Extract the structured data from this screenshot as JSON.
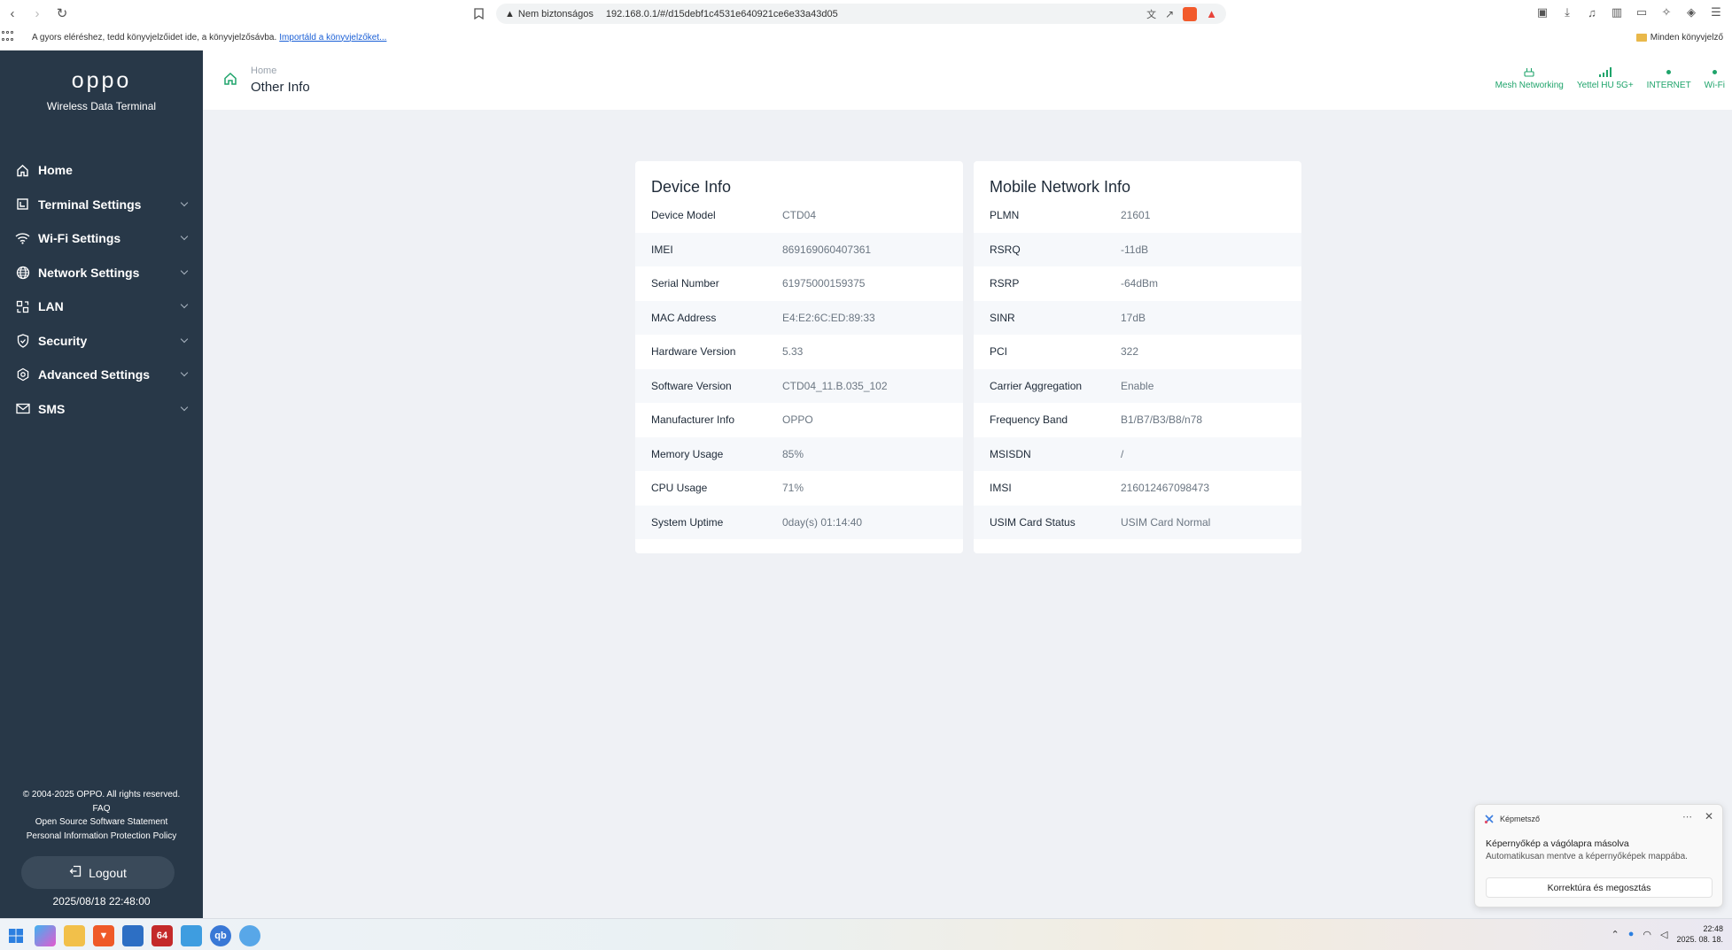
{
  "browser": {
    "security_label": "Nem biztonságos",
    "url": "192.168.0.1/#/d15debf1c4531e640921ce6e33a43d05",
    "bookmarks_hint": "A gyors eléréshez, tedd könyvjelzőidet ide, a könyvjelzősávba.",
    "bookmarks_import": "Importáld a könyvjelzőket...",
    "all_bookmarks": "Minden könyvjelző"
  },
  "sidebar": {
    "logo": "oppo",
    "subtitle": "Wireless Data Terminal",
    "items": [
      {
        "label": "Home",
        "icon": "home-icon",
        "expandable": false
      },
      {
        "label": "Terminal Settings",
        "icon": "terminal-icon",
        "expandable": true
      },
      {
        "label": "Wi-Fi Settings",
        "icon": "wifi-icon",
        "expandable": true
      },
      {
        "label": "Network Settings",
        "icon": "globe-icon",
        "expandable": true
      },
      {
        "label": "LAN",
        "icon": "lan-icon",
        "expandable": true
      },
      {
        "label": "Security",
        "icon": "shield-icon",
        "expandable": true
      },
      {
        "label": "Advanced Settings",
        "icon": "gear-icon",
        "expandable": true
      },
      {
        "label": "SMS",
        "icon": "mail-icon",
        "expandable": true
      }
    ],
    "copyright": "© 2004-2025 OPPO. All rights reserved.",
    "faq": "FAQ",
    "oss": "Open Source Software Statement",
    "privacy": "Personal Information Protection Policy",
    "logout": "Logout",
    "datetime": "2025/08/18 22:48:00"
  },
  "header": {
    "breadcrumb": "Home",
    "title": "Other Info",
    "statuses": [
      {
        "label": "Mesh Networking",
        "icon": "mesh-icon"
      },
      {
        "label": "Yettel HU 5G+",
        "icon": "signal-icon"
      },
      {
        "label": "INTERNET",
        "icon": "dot-icon"
      },
      {
        "label": "Wi-Fi",
        "icon": "dot-icon"
      }
    ],
    "accent": "#1fa46b"
  },
  "device_info": {
    "title": "Device Info",
    "rows": [
      {
        "key": "Device Model",
        "value": "CTD04"
      },
      {
        "key": "IMEI",
        "value": "869169060407361"
      },
      {
        "key": "Serial Number",
        "value": "61975000159375"
      },
      {
        "key": "MAC Address",
        "value": "E4:E2:6C:ED:89:33"
      },
      {
        "key": "Hardware Version",
        "value": "5.33"
      },
      {
        "key": "Software Version",
        "value": "CTD04_11.B.035_102"
      },
      {
        "key": "Manufacturer Info",
        "value": "OPPO"
      },
      {
        "key": "Memory Usage",
        "value": "85%"
      },
      {
        "key": "CPU Usage",
        "value": "71%"
      },
      {
        "key": "System Uptime",
        "value": "0day(s) 01:14:40"
      }
    ]
  },
  "mobile_info": {
    "title": "Mobile Network Info",
    "rows": [
      {
        "key": "PLMN",
        "value": "21601"
      },
      {
        "key": "RSRQ",
        "value": "-11dB"
      },
      {
        "key": "RSRP",
        "value": "-64dBm"
      },
      {
        "key": "SINR",
        "value": "17dB"
      },
      {
        "key": "PCI",
        "value": "322"
      },
      {
        "key": "Carrier Aggregation",
        "value": "Enable"
      },
      {
        "key": "Frequency Band",
        "value": "B1/B7/B3/B8/n78"
      },
      {
        "key": "MSISDN",
        "value": "/"
      },
      {
        "key": "IMSI",
        "value": "216012467098473"
      },
      {
        "key": "USIM Card Status",
        "value": "USIM Card Normal"
      }
    ]
  },
  "toast": {
    "app": "Képmetsző",
    "title": "Képernyőkép a vágólapra másolva",
    "body": "Automatikusan mentve a képernyőképek mappába.",
    "action": "Korrektúra és megosztás"
  },
  "taskbar": {
    "time": "22:48",
    "date": "2025. 08. 18."
  }
}
